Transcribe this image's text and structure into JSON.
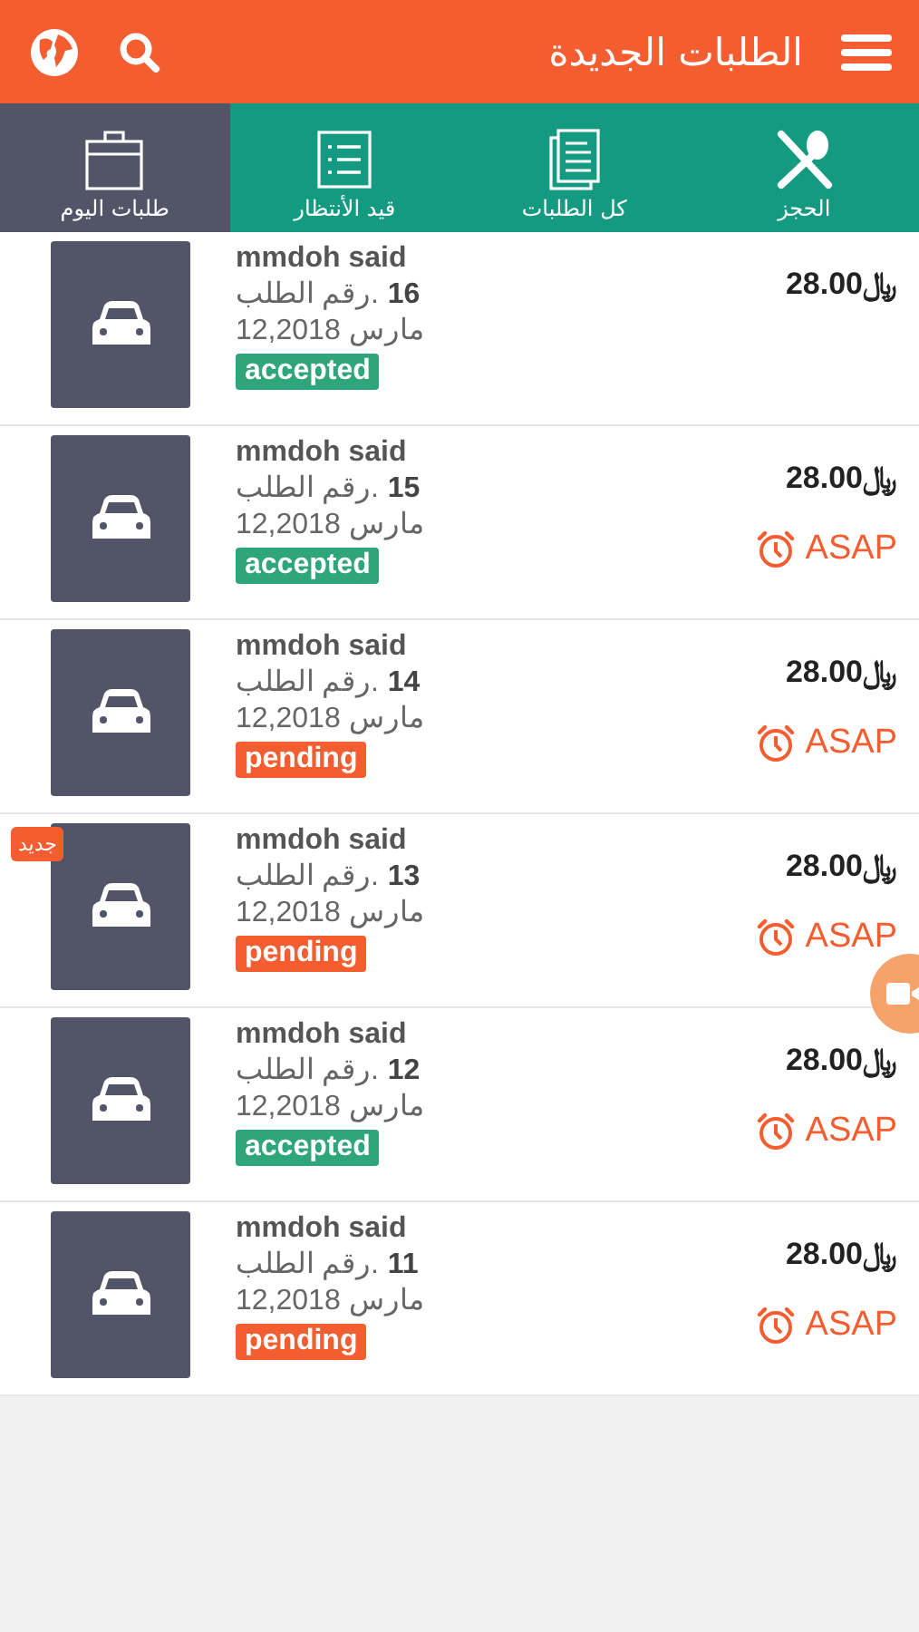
{
  "header": {
    "title": "الطلبات الجديدة"
  },
  "tabs": [
    {
      "label": "الحجز",
      "selected": false
    },
    {
      "label": "كل الطلبات",
      "selected": false
    },
    {
      "label": "قيد الأنتظار",
      "selected": false
    },
    {
      "label": "طلبات اليوم",
      "selected": true
    }
  ],
  "orders": [
    {
      "customer": "mmdoh said",
      "number": "رقم الطلب. **16**",
      "date": "مارس 12,2018",
      "status": "accepted",
      "price": "28.00﷼"
    },
    {
      "customer": "mmdoh said",
      "number": "رقم الطلب. **15**",
      "date": "مارس 12,2018",
      "status": "accepted",
      "price": "28.00﷼",
      "asap": "ASAP"
    },
    {
      "customer": "mmdoh said",
      "number": "رقم الطلب. **14**",
      "date": "مارس 12,2018",
      "status": "pending",
      "price": "28.00﷼",
      "asap": "ASAP"
    },
    {
      "customer": "mmdoh said",
      "number": "رقم الطلب. **13**",
      "date": "مارس 12,2018",
      "status": "pending",
      "price": "28.00﷼",
      "asap": "ASAP",
      "new_badge": "جديد"
    },
    {
      "customer": "mmdoh said",
      "number": "رقم الطلب. **12**",
      "date": "مارس 12,2018",
      "status": "accepted",
      "price": "28.00﷼",
      "asap": "ASAP"
    },
    {
      "customer": "mmdoh said",
      "number": "رقم الطلب. **11**",
      "date": "مارس 12,2018",
      "status": "pending",
      "price": "28.00﷼",
      "asap": "ASAP"
    }
  ]
}
